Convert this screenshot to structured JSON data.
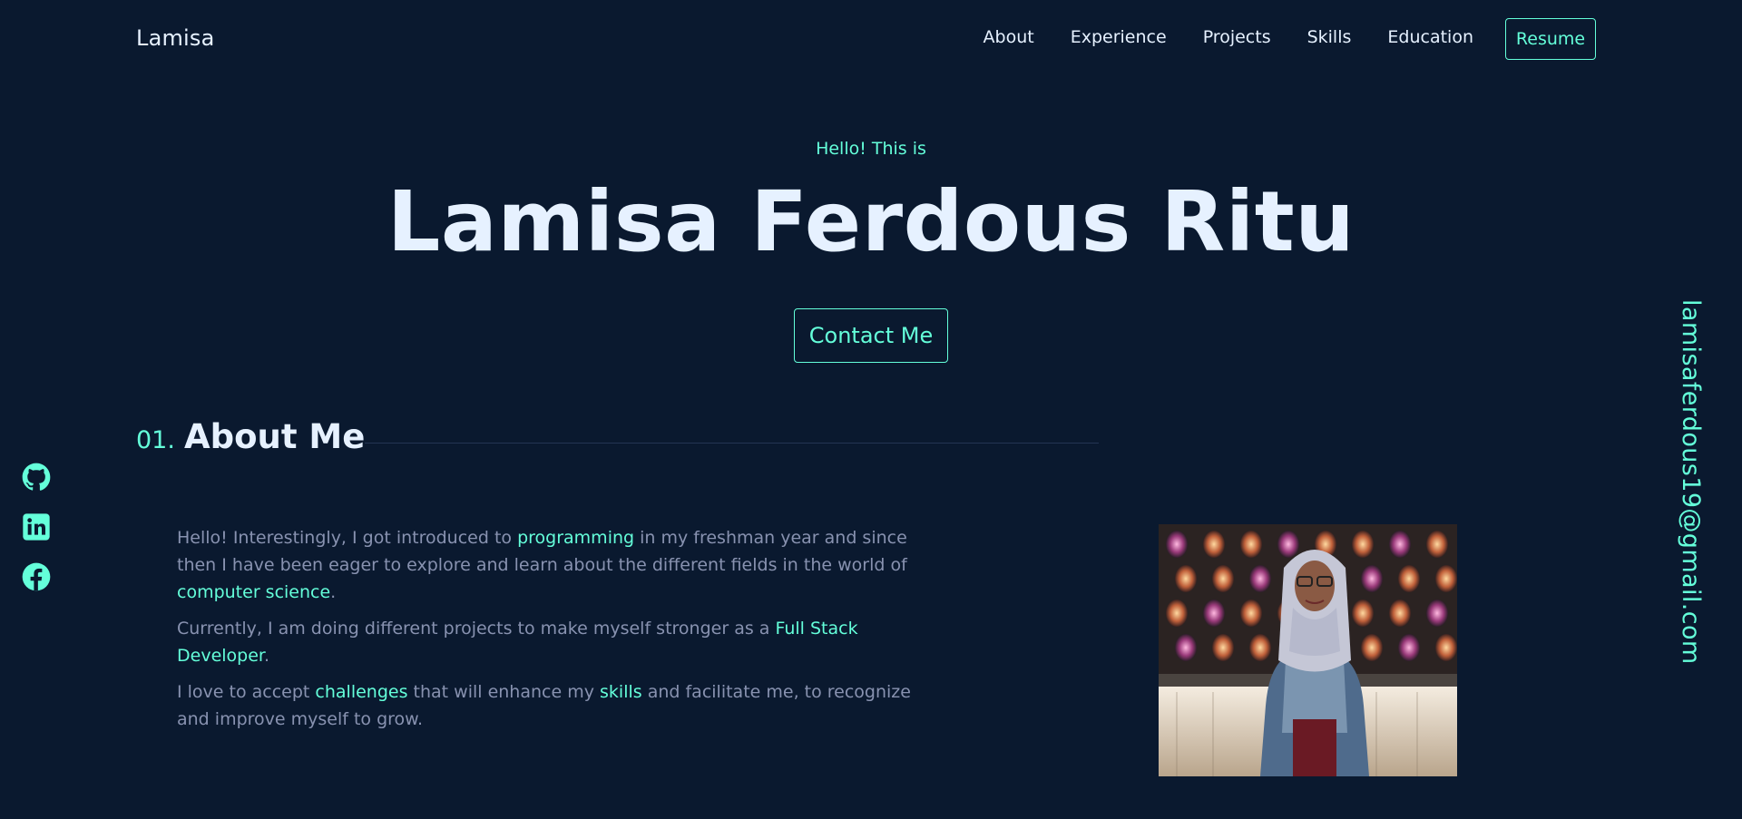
{
  "nav": {
    "logo": "Lamisa",
    "links": [
      "About",
      "Experience",
      "Projects",
      "Skills",
      "Education"
    ],
    "resume_label": "Resume"
  },
  "hero": {
    "greeting": "Hello! This is",
    "name": "Lamisa Ferdous Ritu",
    "contact_label": "Contact Me"
  },
  "about": {
    "number": "01.",
    "title": "About Me",
    "p1": {
      "t1": "Hello! Interestingly, I got introduced to ",
      "h1": "programming",
      "t2": " in my freshman year and since then I have been eager to explore and learn about the different fields in the world of ",
      "h2": "computer science",
      "t3": "."
    },
    "p2": {
      "t1": "Currently, I am doing different projects to make myself stronger as a ",
      "h1": "Full Stack Developer",
      "t2": "."
    },
    "p3": {
      "t1": "I love to accept ",
      "h1": "challenges",
      "t2": " that will enhance my ",
      "h2": "skills",
      "t3": " and facilitate me, to recognize and improve myself to grow."
    }
  },
  "email": "lamisaferdous19@gmail.com",
  "social": [
    "github-icon",
    "linkedin-icon",
    "facebook-icon"
  ],
  "colors": {
    "background": "#0a192f",
    "accent": "#64ffda",
    "text_light": "#e6f1ff",
    "text_muted": "#8892b0",
    "divider": "#233554"
  }
}
